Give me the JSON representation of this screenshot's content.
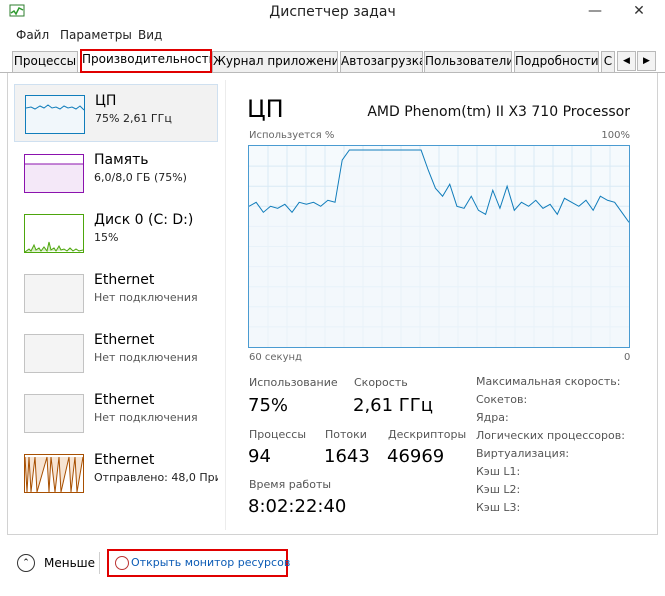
{
  "window": {
    "title": "Диспетчер задач",
    "minimize_glyph": "—",
    "close_glyph": "✕"
  },
  "menu": [
    {
      "label": "Файл"
    },
    {
      "label": "Параметры"
    },
    {
      "label": "Вид"
    }
  ],
  "tabs": [
    {
      "label": "Процессы",
      "active": false
    },
    {
      "label": "Производительность",
      "active": true
    },
    {
      "label": "Журнал приложений",
      "active": false
    },
    {
      "label": "Автозагрузка",
      "active": false
    },
    {
      "label": "Пользователи",
      "active": false
    },
    {
      "label": "Подробности",
      "active": false
    },
    {
      "label": "С",
      "active": false
    }
  ],
  "tab_scroll": {
    "left_glyph": "◀",
    "right_glyph": "▶"
  },
  "sidebar": {
    "items": [
      {
        "label": "ЦП",
        "sub": "75% 2,61 ГГц",
        "color": "#117dbb",
        "selected": true
      },
      {
        "label": "Память",
        "sub": "6,0/8,0 ГБ (75%)",
        "color": "#8b12ae",
        "selected": false
      },
      {
        "label": "Диск 0 (C: D:)",
        "sub": "15%",
        "color": "#4da60c",
        "selected": false
      },
      {
        "label": "Ethernet",
        "sub": "Нет подключения",
        "color": "#c3c3c3",
        "selected": false
      },
      {
        "label": "Ethernet",
        "sub": "Нет подключения",
        "color": "#c3c3c3",
        "selected": false
      },
      {
        "label": "Ethernet",
        "sub": "Нет подключения",
        "color": "#c3c3c3",
        "selected": false
      },
      {
        "label": "Ethernet",
        "sub": "Отправлено: 48,0 Прин",
        "color": "#a74f01",
        "selected": false
      }
    ]
  },
  "cpu": {
    "title": "ЦП",
    "processor": "AMD Phenom(tm) II X3 710 Processor",
    "graph_label": "Используется %",
    "graph_max": "100%",
    "graph_time": "60 секунд",
    "graph_zero": "0",
    "graph_color": "#117dbb",
    "series": [
      70,
      72,
      67,
      70,
      69,
      71,
      67,
      72,
      71,
      72,
      70,
      73,
      72,
      93,
      98,
      98,
      98,
      98,
      98,
      98,
      98,
      98,
      98,
      98,
      98,
      88,
      79,
      75,
      81,
      70,
      69,
      75,
      68,
      66,
      78,
      69,
      80,
      68,
      72,
      70,
      73,
      69,
      71,
      66,
      74,
      72,
      70,
      73,
      68,
      75,
      73,
      72,
      67,
      62
    ],
    "stats": {
      "usage_label": "Использование",
      "usage_value": "75%",
      "speed_label": "Скорость",
      "speed_value": "2,61 ГГц",
      "processes_label": "Процессы",
      "processes_value": "94",
      "threads_label": "Потоки",
      "threads_value": "1643",
      "handles_label": "Дескрипторы",
      "handles_value": "46969",
      "uptime_label": "Время работы",
      "uptime_value": "8:02:22:40"
    },
    "info": [
      "Максимальная скорость:",
      "Сокетов:",
      "Ядра:",
      "Логических процессоров:",
      "Виртуализация:",
      "Кэш L1:",
      "Кэш L2:",
      "Кэш L3:"
    ]
  },
  "footer": {
    "less_label": "Меньше",
    "less_glyph": "⌃",
    "resource_monitor_label": "Открыть монитор ресурсов"
  }
}
